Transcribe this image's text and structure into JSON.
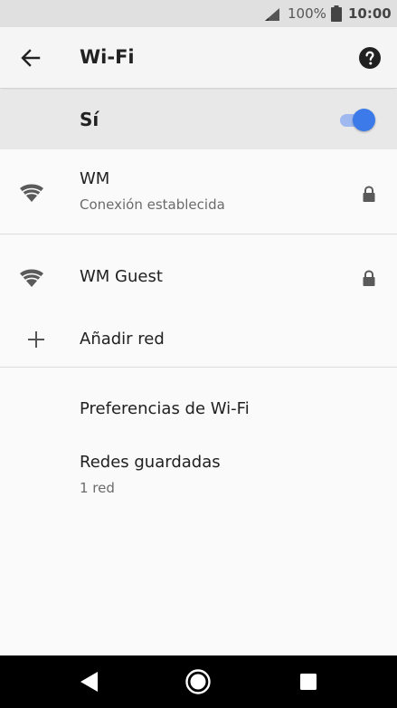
{
  "status_bar": {
    "battery_percent": "100%",
    "time": "10:00"
  },
  "app_bar": {
    "title": "Wi-Fi"
  },
  "master_toggle": {
    "label": "Sí",
    "state": "on"
  },
  "networks": [
    {
      "name": "WM",
      "status": "Conexión establecida",
      "secured": true
    },
    {
      "name": "WM Guest",
      "status": "",
      "secured": true
    }
  ],
  "add_network": {
    "label": "Añadir red"
  },
  "preferences": {
    "label": "Preferencias de Wi-Fi"
  },
  "saved_networks": {
    "label": "Redes guardadas",
    "summary": "1 red"
  },
  "colors": {
    "accent": "#3b7ae8",
    "toggle_track": "#9fb8ef",
    "status_bar_bg": "#e0e0e0",
    "page_bg": "#fafafa"
  }
}
